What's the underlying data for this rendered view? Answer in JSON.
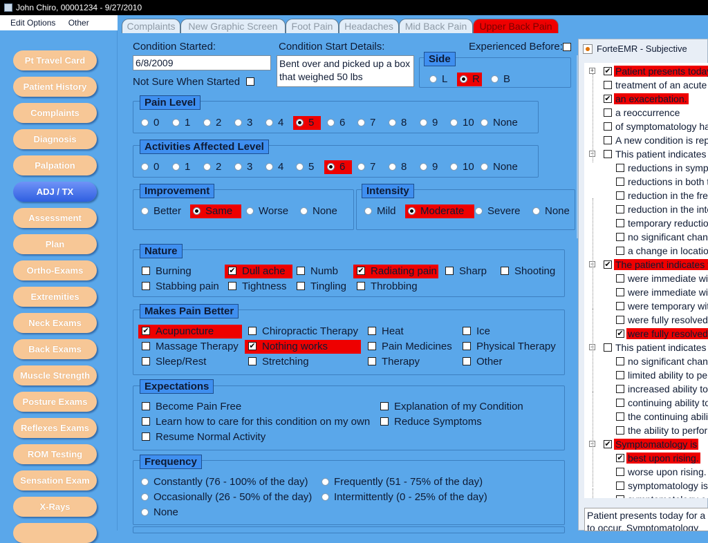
{
  "titlebar": {
    "title": "John Chiro, 00001234 - 9/27/2010"
  },
  "menu": {
    "edit_options": "Edit Options",
    "other": "Other"
  },
  "nav": {
    "items": [
      "Pt Travel Card",
      "Patient History",
      "Complaints",
      "Diagnosis",
      "Palpation",
      "ADJ / TX",
      "Assessment",
      "Plan",
      "Ortho-Exams",
      "Extremities",
      "Neck Exams",
      "Back Exams",
      "Muscle Strength",
      "Posture Exams",
      "Reflexes Exams",
      "ROM Testing",
      "Sensation Exam",
      "X-Rays"
    ],
    "active": "ADJ / TX"
  },
  "tabs": {
    "items": [
      "Complaints",
      "New Graphic Screen",
      "Foot Pain",
      "Headaches",
      "Mid Back Pain",
      "Upper Back Pain"
    ],
    "active": "Upper Back Pain"
  },
  "form": {
    "condition_started_label": "Condition Started:",
    "condition_started_value": "6/8/2009",
    "condition_start_details_label": "Condition Start Details:",
    "condition_start_details_value": "Bent over and picked up a box that weighed 50 lbs",
    "not_sure_label": "Not Sure When Started",
    "not_sure_checked": false,
    "experienced_before_label": "Experienced Before:",
    "experienced_before_checked": false,
    "side": {
      "title": "Side",
      "options": [
        "L",
        "R",
        "B"
      ],
      "selected": "R"
    },
    "pain_level": {
      "title": "Pain Level",
      "options": [
        "0",
        "1",
        "2",
        "3",
        "4",
        "5",
        "6",
        "7",
        "8",
        "9",
        "10",
        "None"
      ],
      "selected": "5"
    },
    "activities_affected": {
      "title": "Activities Affected Level",
      "options": [
        "0",
        "1",
        "2",
        "3",
        "4",
        "5",
        "6",
        "7",
        "8",
        "9",
        "10",
        "None"
      ],
      "selected": "6"
    },
    "improvement": {
      "title": "Improvement",
      "options": [
        "Better",
        "Same",
        "Worse",
        "None"
      ],
      "selected": "Same"
    },
    "intensity": {
      "title": "Intensity",
      "options": [
        "Mild",
        "Moderate",
        "Severe",
        "None"
      ],
      "selected": "Moderate"
    },
    "nature": {
      "title": "Nature",
      "options": [
        "Burning",
        "Dull ache",
        "Numb",
        "Radiating pain",
        "Sharp",
        "Shooting",
        "Stabbing pain",
        "Tightness",
        "Tingling",
        "Throbbing"
      ],
      "checked": [
        "Dull ache",
        "Radiating pain"
      ]
    },
    "makes_pain_better": {
      "title": "Makes Pain Better",
      "options": [
        "Acupuncture",
        "Chiropractic Therapy",
        "Heat",
        "Ice",
        "Massage Therapy",
        "Nothing works",
        "Pain Medicines",
        "Physical Therapy",
        "Sleep/Rest",
        "Stretching",
        "Therapy",
        "Other"
      ],
      "checked": [
        "Acupuncture",
        "Nothing works"
      ]
    },
    "expectations": {
      "title": "Expectations",
      "options": [
        "Become Pain Free",
        "Explanation of my Condition",
        "Learn how to care for this condition on my own",
        "Reduce Symptoms",
        "Resume Normal Activity"
      ],
      "checked": []
    },
    "frequency": {
      "title": "Frequency",
      "options": [
        "Constantly (76 - 100% of the day)",
        "Frequently (51 - 75% of the day)",
        "Occasionally (26 - 50% of the day)",
        "Intermittently (0 - 25% of the day)",
        "None"
      ],
      "selected": null
    }
  },
  "subjective": {
    "title": "ForteEMR - Subjective",
    "tree": [
      {
        "text": "Patient presents today",
        "checked": true,
        "selected": true,
        "level": 0,
        "expander": "+"
      },
      {
        "text": "treatment of an acute",
        "checked": false,
        "selected": false,
        "level": 0
      },
      {
        "text": "an exacerbation.",
        "checked": true,
        "selected": true,
        "level": 0
      },
      {
        "text": "a reoccurrence",
        "checked": false,
        "selected": false,
        "level": 0
      },
      {
        "text": "of symptomatology ha",
        "checked": false,
        "selected": false,
        "level": 0
      },
      {
        "text": "A new condition is rep",
        "checked": false,
        "selected": false,
        "level": 0
      },
      {
        "text": "This patient indicates t",
        "checked": false,
        "selected": false,
        "level": 0,
        "expander": "−"
      },
      {
        "text": "reductions in symp",
        "checked": false,
        "selected": false,
        "level": 1
      },
      {
        "text": "reductions in both t",
        "checked": false,
        "selected": false,
        "level": 1
      },
      {
        "text": "reduction in the fre",
        "checked": false,
        "selected": false,
        "level": 1
      },
      {
        "text": "reduction in the inte",
        "checked": false,
        "selected": false,
        "level": 1
      },
      {
        "text": "temporary reductio",
        "checked": false,
        "selected": false,
        "level": 1
      },
      {
        "text": "no significant chan",
        "checked": false,
        "selected": false,
        "level": 1
      },
      {
        "text": "a change in locatio",
        "checked": false,
        "selected": false,
        "level": 1
      },
      {
        "text": "The patient indicates t",
        "checked": true,
        "selected": true,
        "level": 0,
        "expander": "−"
      },
      {
        "text": "were immediate wi",
        "checked": false,
        "selected": false,
        "level": 1
      },
      {
        "text": "were immediate wi",
        "checked": false,
        "selected": false,
        "level": 1
      },
      {
        "text": "were temporary wit",
        "checked": false,
        "selected": false,
        "level": 1
      },
      {
        "text": "were fully resolved.",
        "checked": false,
        "selected": false,
        "level": 1
      },
      {
        "text": "were fully resolved",
        "checked": true,
        "selected": true,
        "level": 1
      },
      {
        "text": "This patient indicates t",
        "checked": false,
        "selected": false,
        "level": 0,
        "expander": "−"
      },
      {
        "text": "no significant chan",
        "checked": false,
        "selected": false,
        "level": 1
      },
      {
        "text": "limited ability to per",
        "checked": false,
        "selected": false,
        "level": 1
      },
      {
        "text": "increased ability to",
        "checked": false,
        "selected": false,
        "level": 1
      },
      {
        "text": "continuing ability to",
        "checked": false,
        "selected": false,
        "level": 1
      },
      {
        "text": "the continuing abilit",
        "checked": false,
        "selected": false,
        "level": 1
      },
      {
        "text": "the ability to perfor",
        "checked": false,
        "selected": false,
        "level": 1
      },
      {
        "text": "Symptomatology is",
        "checked": true,
        "selected": true,
        "level": 0,
        "expander": "−"
      },
      {
        "text": "best upon rising.",
        "checked": true,
        "selected": true,
        "level": 1
      },
      {
        "text": "worse upon rising.",
        "checked": false,
        "selected": false,
        "level": 1
      },
      {
        "text": "symptomatology is",
        "checked": false,
        "selected": false,
        "level": 1
      },
      {
        "text": "symptomatology c",
        "checked": false,
        "selected": false,
        "level": 1
      }
    ],
    "text_lines": [
      "Patient presents today for a",
      "to occur. Symptomatology"
    ]
  },
  "colors": {
    "selected_red": "#ee0000",
    "background_blue": "#5aa7ea",
    "section_title_blue": "#3f8ff0",
    "nav_button": "#f7c796",
    "nav_active": "#2f5fe0"
  }
}
